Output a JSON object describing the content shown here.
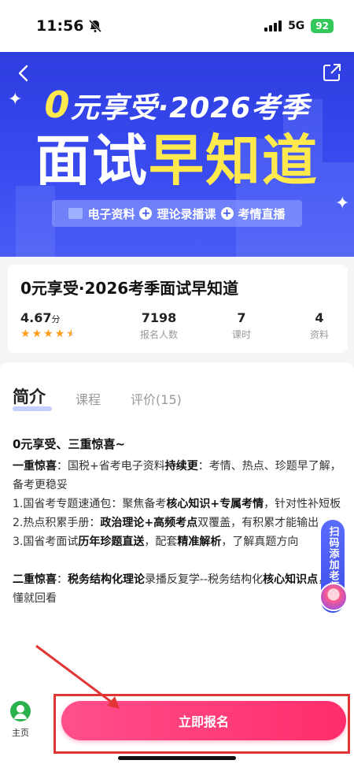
{
  "status_bar": {
    "time": "11:56",
    "network": "5G",
    "battery": "92"
  },
  "banner": {
    "subtitle_zero": "0",
    "subtitle_rest": "元享受·2026考季",
    "title_white": "面试",
    "title_yellow": "早知道",
    "features": [
      "电子资料",
      "理论录播课",
      "考情直播"
    ]
  },
  "course": {
    "title": "0元享受·2026考季面试早知道",
    "rating": "4.67",
    "rating_unit": "分",
    "rating_stars": 4.67,
    "stats": [
      {
        "value": "7198",
        "label": "报名人数"
      },
      {
        "value": "7",
        "label": "课时"
      },
      {
        "value": "4",
        "label": "资料"
      }
    ]
  },
  "tabs": {
    "intro": "简介",
    "course": "课程",
    "review": "评价(15)"
  },
  "description": {
    "heading": "0元享受、三重惊喜~",
    "surprise1_label": "一重惊喜",
    "surprise1_a": "：国税+省考电子资料",
    "surprise1_b": "持续更",
    "surprise1_c": "：考情、热点、珍题早了解，备考更稳妥",
    "item1_a": "1.国省考专题速通包：聚焦备考",
    "item1_b": "核心知识+专属考情",
    "item1_c": "，针对性补短板",
    "item2_a": "2.热点积累手册：",
    "item2_b": "政治理论+高频考点",
    "item2_c": "双覆盖，有积累才能输出",
    "item3_a": "3.国省考面试",
    "item3_b": "历年珍题直送",
    "item3_c": "，配套",
    "item3_d": "精准解析",
    "item3_e": "，了解真题方向",
    "surprise2_label": "二重惊喜",
    "surprise2_a": "：",
    "surprise2_b": "税务结构化理论",
    "surprise2_c": "录播反复学--税务结构化",
    "surprise2_d": "核心知识点",
    "surprise2_e": "，不懂就回看"
  },
  "float_tag": {
    "label": "扫码添加老师"
  },
  "bottom_bar": {
    "home_label": "主页",
    "enroll_label": "立即报名"
  },
  "colors": {
    "banner_blue": "#3a4cf0",
    "accent_yellow": "#ffe94d",
    "cta_pink": "#ff2d6b",
    "annotation_red": "#e23636"
  }
}
